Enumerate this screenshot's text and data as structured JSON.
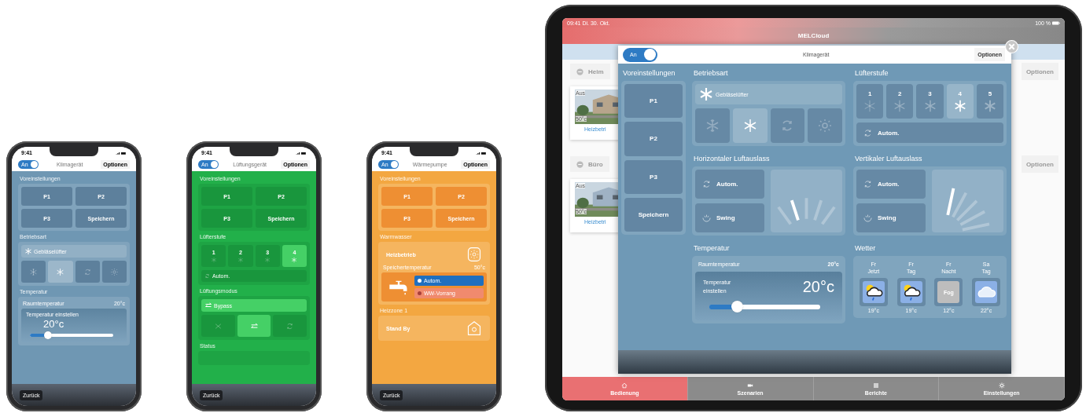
{
  "phones": [
    {
      "kind": "air",
      "time": "9:41",
      "power": {
        "label": "An",
        "on": true
      },
      "title": "Klimagerät",
      "options": "Optionen",
      "back": "Zurück",
      "sections": [
        {
          "kind": "presets",
          "title": "Voreinstellungen",
          "buttons": [
            "P1",
            "P2",
            "P3",
            "Speichern"
          ]
        },
        {
          "kind": "mode",
          "title": "Betriebsart",
          "current": "Gebläselüfter",
          "options": [
            {
              "selected": false
            },
            {
              "selected": true
            },
            {
              "selected": false
            },
            {
              "selected": false
            }
          ]
        },
        {
          "kind": "temperature",
          "title": "Temperatur",
          "room_label": "Raumtemperatur",
          "room_value": "20°c",
          "set_label": "Temperatur einstellen",
          "set_value": "20°c",
          "level": 0.22
        }
      ]
    },
    {
      "kind": "vent",
      "time": "9:41",
      "power": {
        "label": "An",
        "on": true
      },
      "title": "Lüftungsgerät",
      "options": "Optionen",
      "back": "Zurück",
      "sections": [
        {
          "kind": "presets",
          "title": "Voreinstellungen",
          "buttons": [
            "P1",
            "P2",
            "P3",
            "Speichern"
          ]
        },
        {
          "kind": "fanspeed",
          "title": "Lüfterstufe",
          "steps": [
            {
              "label": "1",
              "selected": false
            },
            {
              "label": "2",
              "selected": false
            },
            {
              "label": "3",
              "selected": false
            },
            {
              "label": "4",
              "selected": true
            }
          ],
          "auto": "Autom."
        },
        {
          "kind": "ventmode",
          "title": "Lüftungsmodus",
          "current": "Bypass",
          "options": [
            {
              "selected": false
            },
            {
              "selected": true
            },
            {
              "selected": false
            }
          ]
        },
        {
          "kind": "status",
          "title": "Status"
        }
      ]
    },
    {
      "kind": "heat",
      "time": "9:41",
      "power": {
        "label": "An",
        "on": true
      },
      "title": "Wärmepumpe",
      "options": "Optionen",
      "back": "Zurück",
      "sections": [
        {
          "kind": "presets",
          "title": "Voreinstellungen",
          "buttons": [
            "P1",
            "P2",
            "P3",
            "Speichern"
          ]
        },
        {
          "kind": "hotwater",
          "title": "Warmwasser",
          "mode": "Heizbetrieb",
          "tank_label": "Speichertemperatur",
          "tank_value": "50°c",
          "options": [
            {
              "label": "Autom.",
              "selected": true
            },
            {
              "label": "WW-Vorrang",
              "selected": false
            }
          ]
        },
        {
          "kind": "zone",
          "title": "Heizzone 1",
          "mode": "Stand By"
        }
      ]
    }
  ],
  "tablet": {
    "time": "09:41 Di. 30. Okt.",
    "battery": "100 %",
    "title": "MELCloud",
    "groups": [
      {
        "name": "Heim",
        "options": "Optionen",
        "card": {
          "state": "Aus",
          "temp": "50°c",
          "mode": "Heizbetri"
        }
      },
      {
        "name": "Büro",
        "options": "Optionen",
        "card": {
          "state": "Aus",
          "temp": "50°c",
          "mode": "Heizbetri"
        }
      }
    ],
    "modal": {
      "power": {
        "label": "An",
        "on": true
      },
      "title": "Klimagerät",
      "options": "Optionen",
      "presets": {
        "title": "Voreinstellungen",
        "buttons": [
          "P1",
          "P2",
          "P3",
          "Speichern"
        ]
      },
      "sections": [
        {
          "kind": "mode",
          "title": "Betriebsart",
          "current": "Gebläselüfter",
          "options": [
            {
              "selected": false
            },
            {
              "selected": true
            },
            {
              "selected": false
            },
            {
              "selected": false
            }
          ]
        },
        {
          "kind": "fanspeed",
          "title": "Lüfterstufe",
          "steps": [
            {
              "label": "1",
              "selected": false
            },
            {
              "label": "2",
              "selected": false
            },
            {
              "label": "3",
              "selected": false
            },
            {
              "label": "4",
              "selected": true
            },
            {
              "label": "5",
              "selected": false
            }
          ],
          "auto": "Autom."
        },
        {
          "kind": "vane-horizontal",
          "title": "Horizontaler Luftauslass",
          "auto": "Autom.",
          "swing": "Swing",
          "positions": [
            {
              "selected": false
            },
            {
              "selected": true
            },
            {
              "selected": false
            },
            {
              "selected": false
            },
            {
              "selected": false
            }
          ]
        },
        {
          "kind": "vane-vertical",
          "title": "Vertikaler Luftauslass",
          "auto": "Autom.",
          "swing": "Swing",
          "positions": [
            {
              "selected": true
            },
            {
              "selected": false
            },
            {
              "selected": false
            },
            {
              "selected": false
            },
            {
              "selected": false
            }
          ]
        },
        {
          "kind": "temperature",
          "title": "Temperatur",
          "room_label": "Raumtemperatur",
          "room_value": "20°c",
          "set_label": "Temperatur einstellen",
          "set_value": "20°c",
          "level": 0.25
        },
        {
          "kind": "weather",
          "title": "Wetter",
          "days": [
            {
              "day": "Fr",
              "time": "Jetzt",
              "kind": "sun-rain",
              "temp": "19°c"
            },
            {
              "day": "Fr",
              "time": "Tag",
              "kind": "sun-rain",
              "temp": "19°c"
            },
            {
              "day": "Fr",
              "time": "Nacht",
              "kind": "fog",
              "label": "Fog",
              "temp": "12°c"
            },
            {
              "day": "Sa",
              "time": "Tag",
              "kind": "cloud",
              "temp": "22°c"
            }
          ]
        }
      ]
    },
    "tabs": [
      {
        "label": "Bedienung",
        "selected": true
      },
      {
        "label": "Szenarien",
        "selected": false
      },
      {
        "label": "Berichte",
        "selected": false
      },
      {
        "label": "Einstellungen",
        "selected": false
      }
    ]
  }
}
